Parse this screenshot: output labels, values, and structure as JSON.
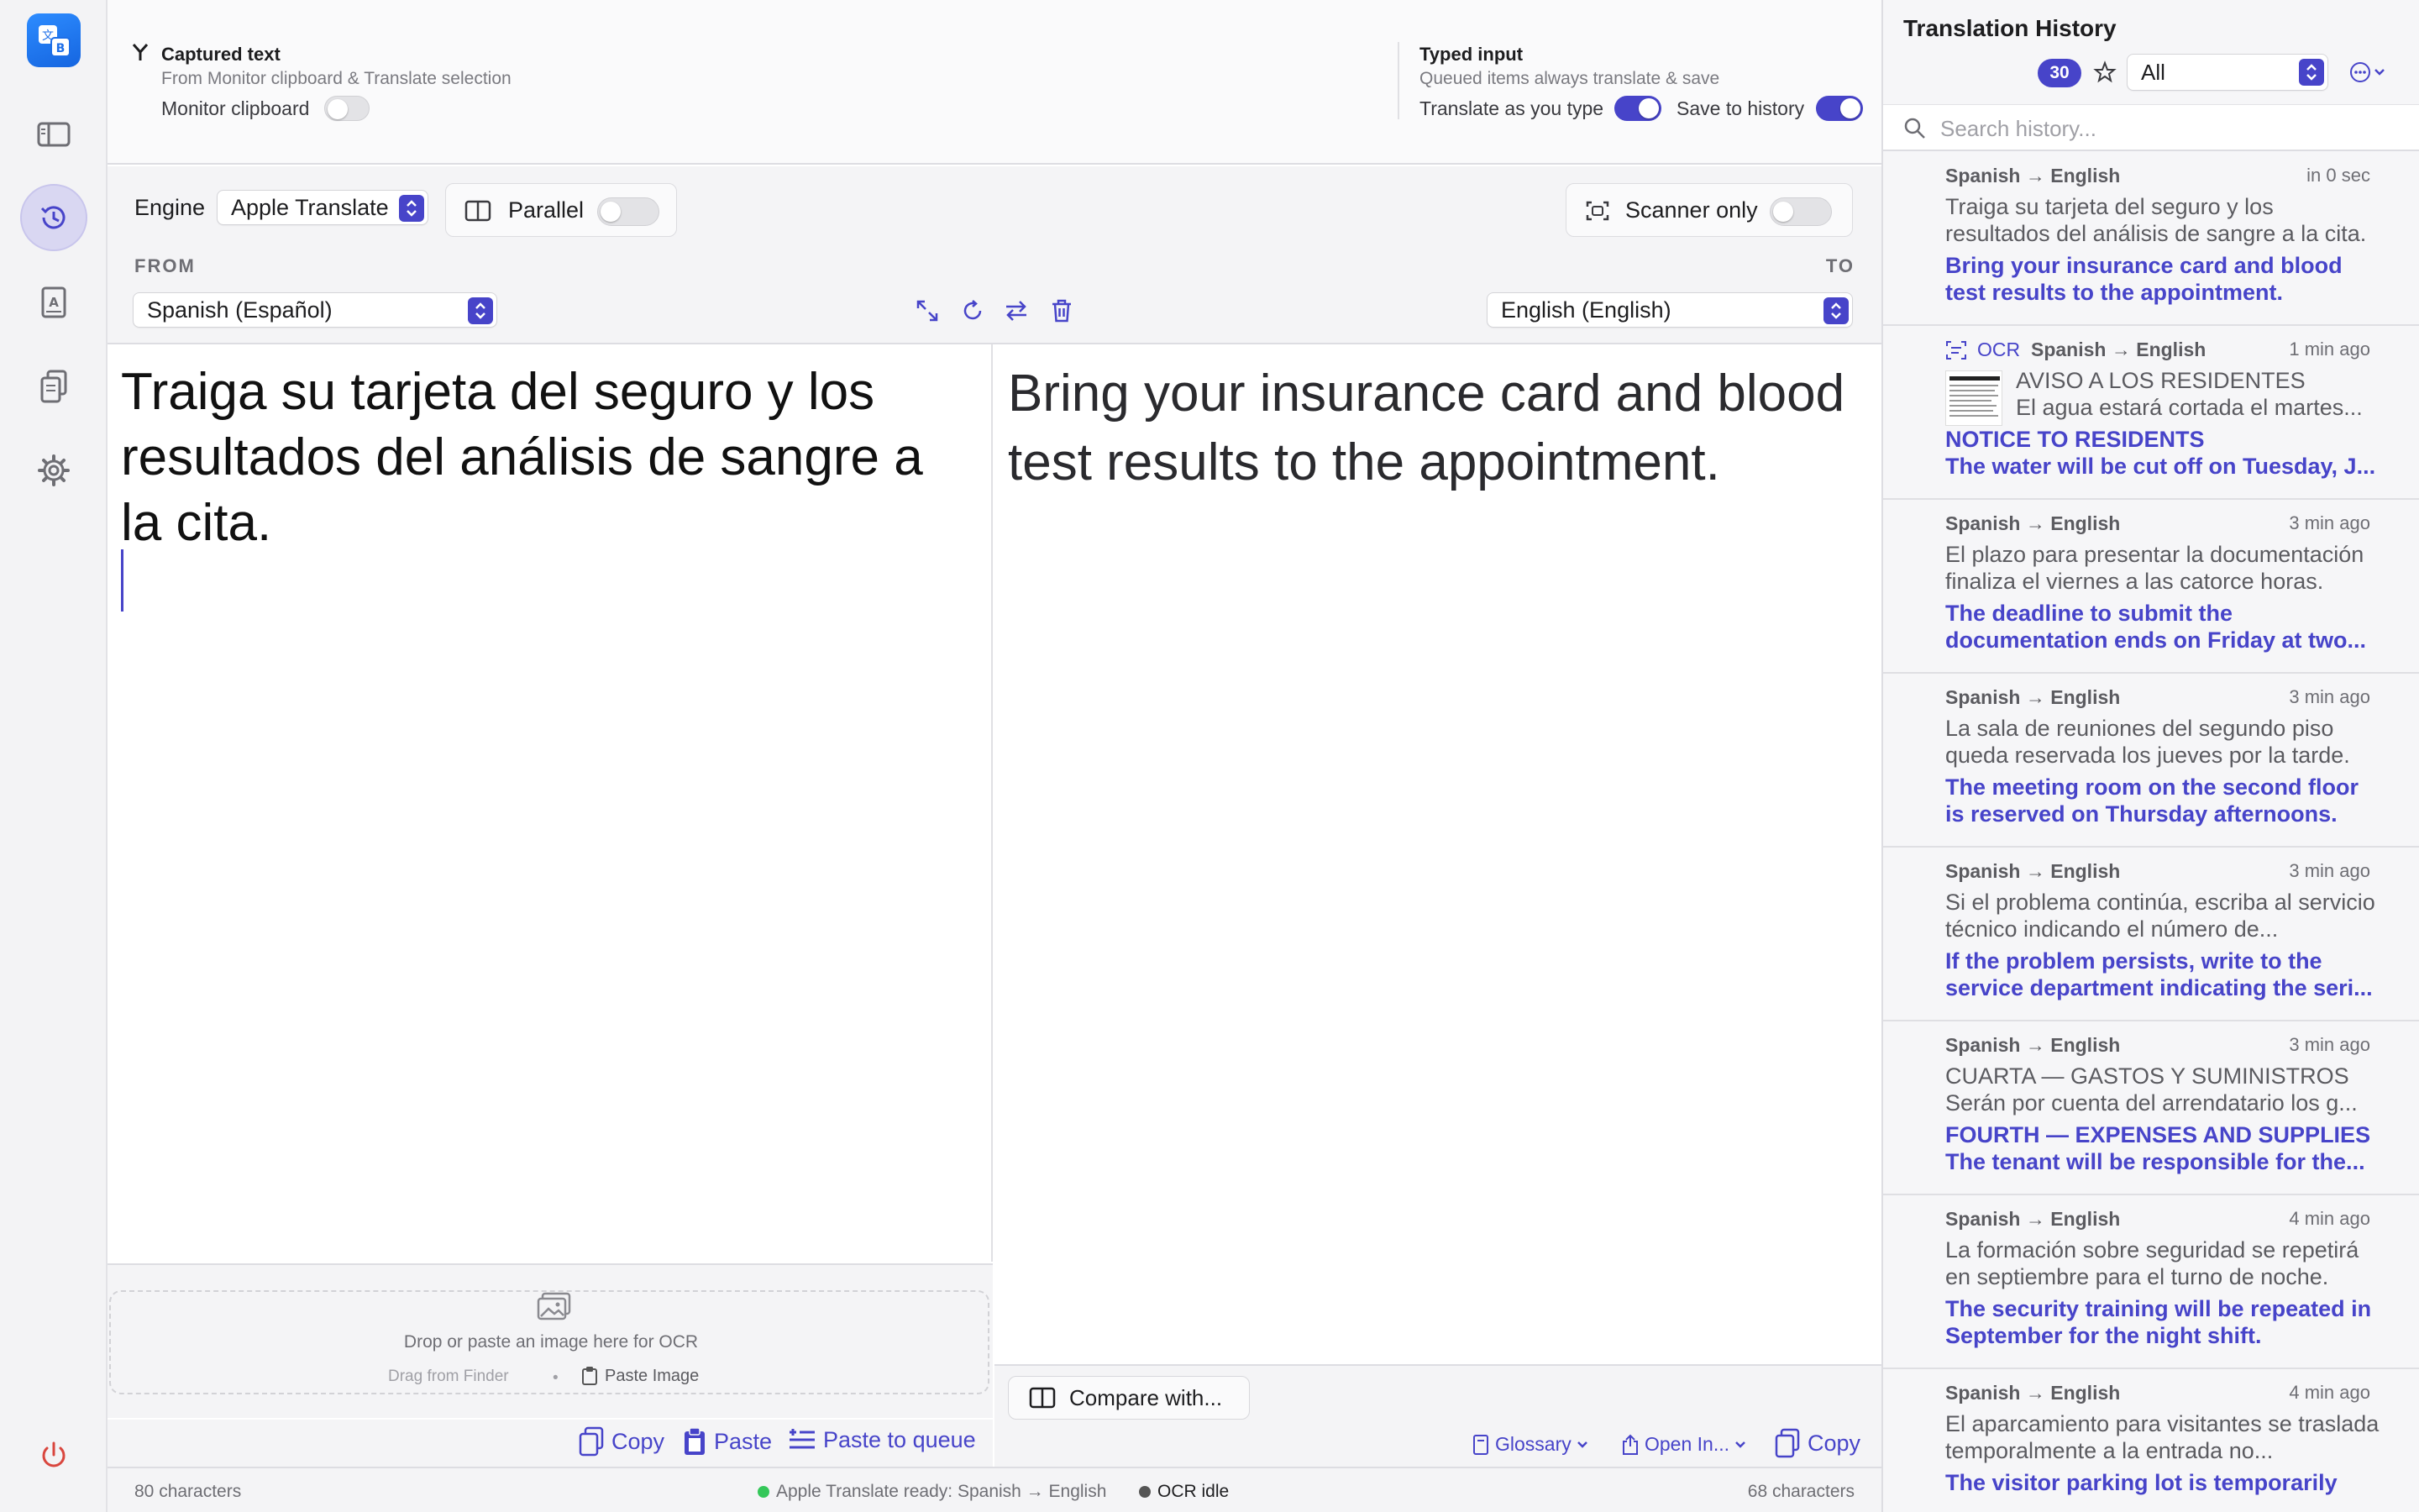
{
  "sidebar": {
    "items": [
      {
        "name": "sidebar-toggle",
        "icon": "sidebar-icon"
      },
      {
        "name": "history",
        "icon": "clock-history-icon",
        "active": true
      },
      {
        "name": "dictionary",
        "icon": "dictionary-book-icon"
      },
      {
        "name": "documents",
        "icon": "documents-icon"
      },
      {
        "name": "settings",
        "icon": "gear-icon"
      }
    ],
    "power_icon": "power-icon",
    "accent": "#4744c9"
  },
  "capture": {
    "title": "Captured text",
    "subtitle": "From Monitor clipboard & Translate selection",
    "monitor_label": "Monitor clipboard",
    "monitor_on": false
  },
  "typed": {
    "title": "Typed input",
    "subtitle": "Queued items always translate & save",
    "translate_label": "Translate as you type",
    "translate_on": true,
    "save_label": "Save to history",
    "save_on": true
  },
  "controls": {
    "engine_label": "Engine",
    "engine_value": "Apple Translate",
    "parallel_label": "Parallel",
    "parallel_on": false,
    "scanner_label": "Scanner only",
    "scanner_on": false,
    "from_label": "FROM",
    "to_label": "TO",
    "from_lang": "Spanish (Español)",
    "to_lang": "English (English)"
  },
  "source": {
    "text": "Traiga su tarjeta del seguro y los resultados del análisis de sangre a la cita."
  },
  "target": {
    "text": "Bring your insurance card and blood test results to the appointment."
  },
  "ocr": {
    "drop_text": "Drop or paste an image here for OCR",
    "drag_text": "Drag from Finder",
    "paste_image": "Paste Image"
  },
  "source_actions": {
    "copy": "Copy",
    "paste": "Paste",
    "paste_queue": "Paste to queue"
  },
  "target_actions": {
    "compare": "Compare with...",
    "glossary": "Glossary",
    "open_in": "Open In...",
    "copy": "Copy"
  },
  "status": {
    "source_chars": "80 characters",
    "engine_status": "Apple Translate ready: Spanish → English",
    "ocr_status": "OCR idle",
    "target_chars": "68 characters",
    "engine_color": "#34c759",
    "ocr_color": "#555555"
  },
  "history": {
    "title": "Translation History",
    "count": "30",
    "filter": "All",
    "search_placeholder": "Search history...",
    "items": [
      {
        "dir": "Spanish → English",
        "time": "in 0 sec",
        "ocr": false,
        "src": "Traiga su tarjeta del seguro y los resultados del análisis de sangre a la cita.",
        "tgt": "Bring your insurance card and blood test results to the appointment."
      },
      {
        "dir": "Spanish → English",
        "time": "1 min ago",
        "ocr": true,
        "ocr_label": "OCR",
        "src1": "AVISO A LOS RESIDENTES",
        "src2": "El agua estará cortada el martes...",
        "tgt1": "NOTICE TO RESIDENTS",
        "tgt2": "The water will be cut off on Tuesday, J..."
      },
      {
        "dir": "Spanish → English",
        "time": "3 min ago",
        "ocr": false,
        "src": "El plazo para presentar la documentación finaliza el viernes a las catorce horas.",
        "tgt": "The deadline to submit the documentation ends on Friday at two..."
      },
      {
        "dir": "Spanish → English",
        "time": "3 min ago",
        "ocr": false,
        "src": "La sala de reuniones del segundo piso queda reservada los jueves por la tarde.",
        "tgt": "The meeting room on the second floor is reserved on Thursday afternoons."
      },
      {
        "dir": "Spanish → English",
        "time": "3 min ago",
        "ocr": false,
        "src": "Si el problema continúa, escriba al servicio técnico indicando el número de...",
        "tgt": "If the problem persists, write to the service department indicating the seri..."
      },
      {
        "dir": "Spanish → English",
        "time": "3 min ago",
        "ocr": false,
        "src1": "CUARTA — GASTOS Y SUMINISTROS",
        "src2": "Serán por cuenta del arrendatario los g...",
        "tgt1": "FOURTH — EXPENSES AND SUPPLIES",
        "tgt2": "The tenant will be responsible for the..."
      },
      {
        "dir": "Spanish → English",
        "time": "4 min ago",
        "ocr": false,
        "src": "La formación sobre seguridad se repetirá en septiembre para el turno de noche.",
        "tgt": "The security training will be repeated in September for the night shift."
      },
      {
        "dir": "Spanish → English",
        "time": "4 min ago",
        "ocr": false,
        "src": "El aparcamiento para visitantes se traslada temporalmente a la entrada no...",
        "tgt": "The visitor parking lot is temporarily"
      }
    ]
  }
}
